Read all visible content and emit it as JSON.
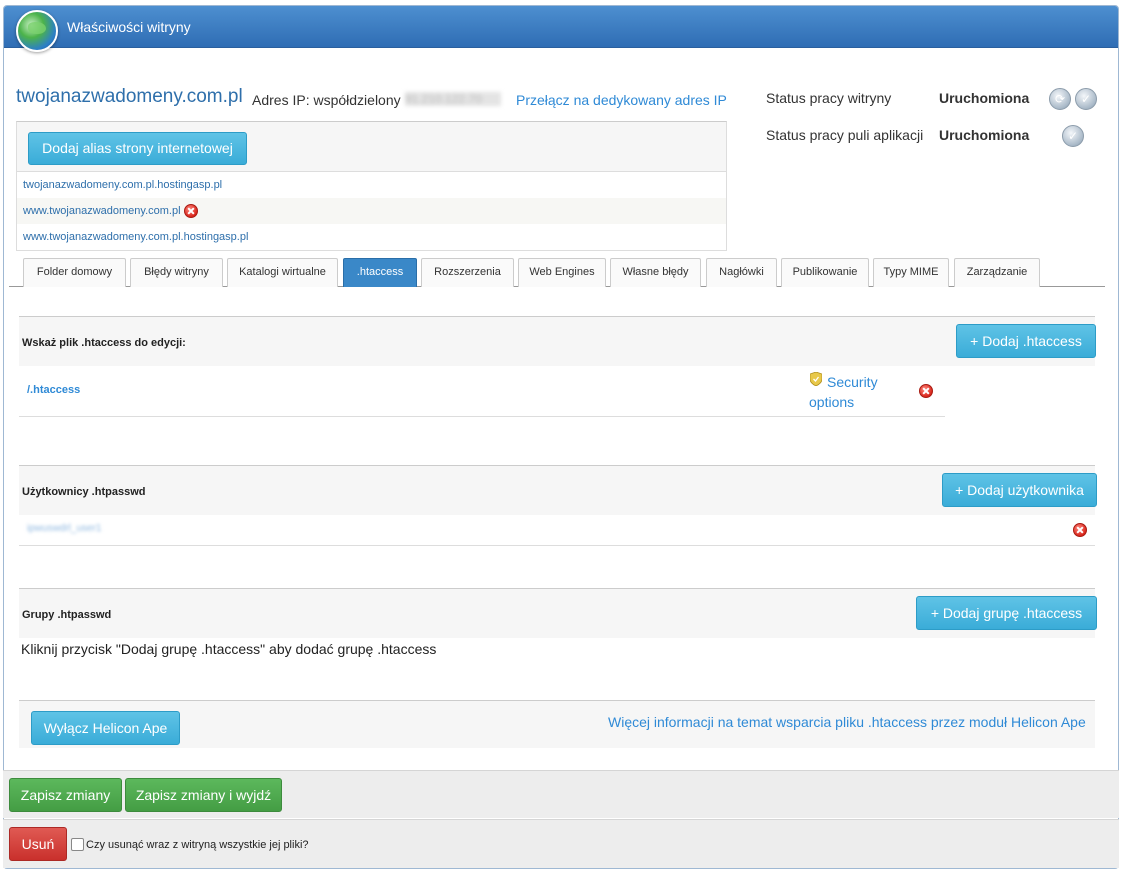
{
  "window": {
    "title": "Właściwości witryny"
  },
  "site": {
    "domain": "twojanazwadomeny.com.pl",
    "ip_label": "Adres IP: współdzielony",
    "ip_value_blurred": "91.210.122.70",
    "switch_ip_link": "Przełącz na dedykowany adres IP"
  },
  "status": {
    "site_label": "Status pracy witryny",
    "site_value": "Uruchomiona",
    "pool_label": "Status pracy puli aplikacji",
    "pool_value": "Uruchomiona"
  },
  "aliases": {
    "add_button": "Dodaj alias strony internetowej",
    "items": [
      {
        "name": "twojanazwadomeny.com.pl.hostingasp.pl",
        "deletable": false
      },
      {
        "name": "www.twojanazwadomeny.com.pl",
        "deletable": true
      },
      {
        "name": "www.twojanazwadomeny.com.pl.hostingasp.pl",
        "deletable": false
      }
    ]
  },
  "tabs": [
    "Folder domowy",
    "Błędy witryny",
    "Katalogi wirtualne",
    ".htaccess",
    "Rozszerzenia",
    "Web Engines",
    "Własne błędy",
    "Nagłówki",
    "Publikowanie",
    "Typy MIME",
    "Zarządzanie"
  ],
  "active_tab": ".htaccess",
  "htaccess": {
    "label": "Wskaż plik .htaccess do edycji:",
    "add_button": "+ Dodaj .htaccess",
    "file": "/.htaccess",
    "security_line1": "Security",
    "security_line2": "options"
  },
  "users": {
    "label": "Użytkownicy .htpasswd",
    "add_button": "+ Dodaj użytkownika",
    "item_blurred": "ipwuswdrl_user1"
  },
  "groups": {
    "label": "Grupy .htpasswd",
    "add_button": "+ Dodaj grupę .htaccess",
    "hint": "Kliknij przycisk \"Dodaj grupę .htaccess\" aby dodać grupę .htaccess"
  },
  "helicon": {
    "disable_button": "Wyłącz Helicon Ape",
    "info_link": "Więcej informacji na temat wsparcia pliku .htaccess przez moduł Helicon Ape"
  },
  "footer": {
    "save": "Zapisz zmiany",
    "save_exit": "Zapisz zmiany i wyjdź",
    "delete": "Usuń",
    "delete_files_label": "Czy usunąć wraz z witryną wszystkie jej pliki?"
  },
  "colors": {
    "primary": "#2f6db4",
    "button_blue": "#3aacd8",
    "button_green": "#449d44",
    "button_red": "#c9302c",
    "link": "#2f8ad6"
  }
}
